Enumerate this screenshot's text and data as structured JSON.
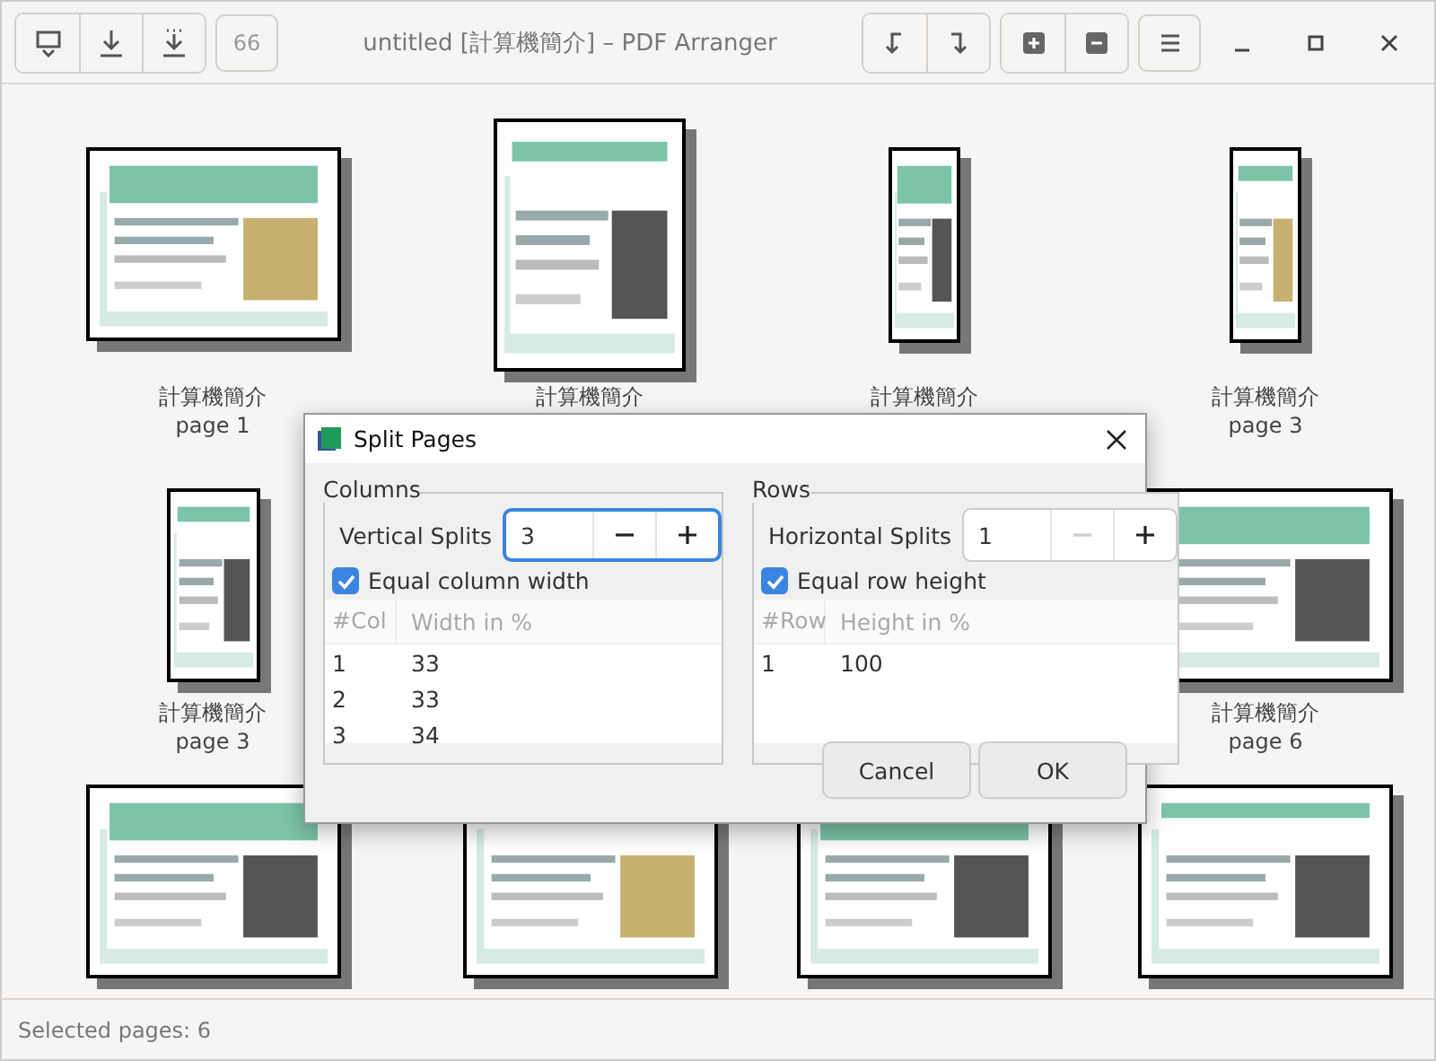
{
  "window": {
    "title": "untitled [計算機簡介] – PDF Arranger"
  },
  "toolbar": {
    "page_count_button": {
      "label": "66",
      "disabled": true
    }
  },
  "pages": [
    {
      "kind": "landscape",
      "name": "計算機簡介",
      "page": "page 1"
    },
    {
      "kind": "portrait",
      "name": "計算機簡介"
    },
    {
      "kind": "narrow",
      "name": "計算機簡介"
    },
    {
      "kind": "narrow",
      "name": "計算機簡介",
      "page": "page 3"
    },
    {
      "kind": "half",
      "name": "計算機簡介",
      "page": "page 3"
    },
    {
      "kind": "landscape",
      "name": "計算機簡介",
      "page": "page 6"
    },
    {
      "kind": "landscape"
    },
    {
      "kind": "landscape"
    },
    {
      "kind": "landscape"
    },
    {
      "kind": "landscape"
    }
  ],
  "dialog": {
    "title": "Split Pages",
    "columns": {
      "title": "Columns",
      "splits_label": "Vertical Splits",
      "value": "3",
      "focused": true,
      "minus_disabled": false,
      "equal_label": "Equal column width",
      "checked": true,
      "headers": [
        "#Col",
        "Width in %"
      ],
      "rows": [
        [
          "1",
          "33"
        ],
        [
          "2",
          "33"
        ],
        [
          "3",
          "34"
        ]
      ]
    },
    "rows": {
      "title": "Rows",
      "splits_label": "Horizontal Splits",
      "value": "1",
      "focused": false,
      "minus_disabled": true,
      "equal_label": "Equal row height",
      "checked": true,
      "headers": [
        "#Row",
        "Height in %"
      ],
      "rows": [
        [
          "1",
          "100"
        ]
      ]
    },
    "buttons": [
      "Cancel",
      "OK"
    ]
  },
  "status_bar": {
    "text": "Selected pages: 6"
  }
}
